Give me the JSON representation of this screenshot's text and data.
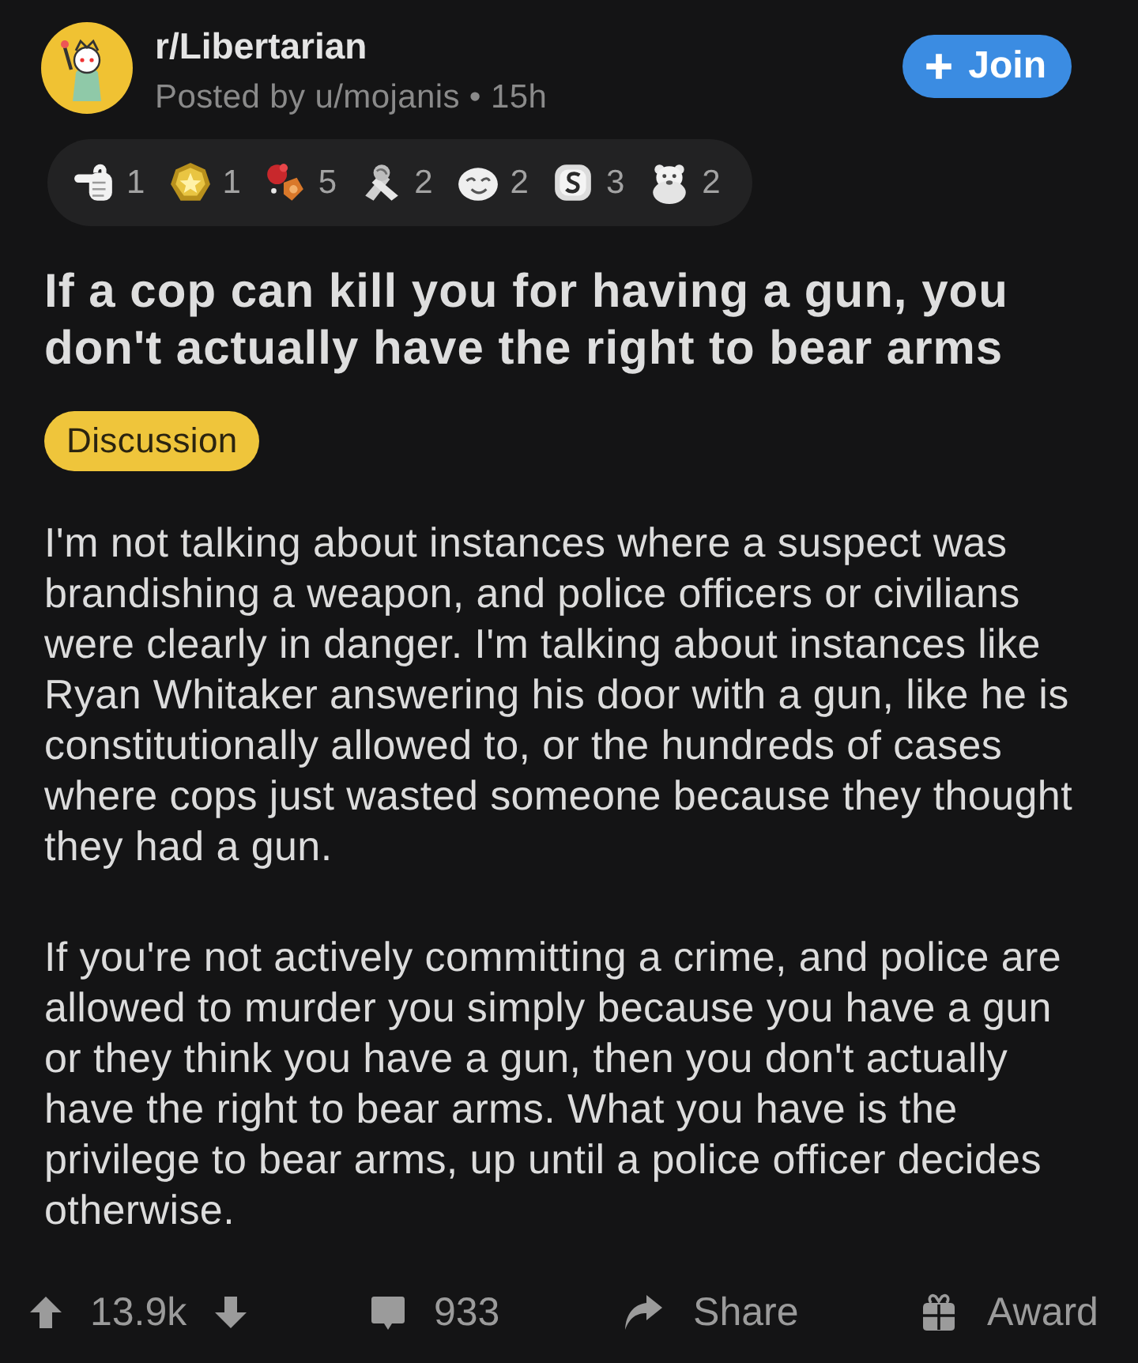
{
  "post": {
    "subreddit": "r/Libertarian",
    "byline": "Posted by u/mojanis • 15h"
  },
  "join_button": {
    "label": "Join"
  },
  "awards": [
    {
      "kind": "hand",
      "count": "1"
    },
    {
      "kind": "star-badge",
      "count": "1"
    },
    {
      "kind": "confetti",
      "count": "5"
    },
    {
      "kind": "ribbon",
      "count": "2"
    },
    {
      "kind": "face",
      "count": "2"
    },
    {
      "kind": "jar",
      "count": "3"
    },
    {
      "kind": "bear",
      "count": "2"
    }
  ],
  "title": "If a cop can kill you for having a gun, you don't actually have the right to bear arms",
  "flair": "Discussion",
  "body": [
    "I'm not talking about instances where a suspect was brandishing a weapon, and police officers or civilians were clearly in danger. I'm talking about instances like Ryan Whitaker answering his door with a gun, like he is constitutionally allowed to, or the hundreds of cases where cops just wasted someone because they thought they had a gun.",
    "If you're not actively committing a crime, and police are allowed to murder you simply because you have a gun or they think you have a gun, then you don't actually have the right to bear arms. What you have is the privilege to bear arms, up until a police officer decides otherwise."
  ],
  "actions": {
    "score": "13.9k",
    "comments": "933",
    "share": "Share",
    "award": "Award"
  }
}
